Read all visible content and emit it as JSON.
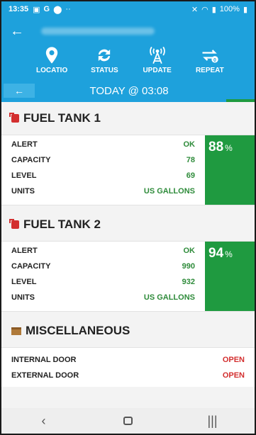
{
  "status_bar": {
    "time": "13:35",
    "battery": "100%"
  },
  "app_bar": {
    "back_icon": "arrow-left-icon"
  },
  "actions": [
    {
      "label": "LOCATIO",
      "icon": "location-pin-icon"
    },
    {
      "label": "STATUS",
      "icon": "refresh-icon"
    },
    {
      "label": "UPDATE",
      "icon": "antenna-icon"
    },
    {
      "label": "REPEAT",
      "icon": "repeat-icon"
    }
  ],
  "date_bar": {
    "text": "TODAY @ 03:08"
  },
  "sections": {
    "tank1": {
      "title": "FUEL TANK 1",
      "rows": [
        {
          "key": "ALERT",
          "value": "OK"
        },
        {
          "key": "CAPACITY",
          "value": "78"
        },
        {
          "key": "LEVEL",
          "value": "69"
        },
        {
          "key": "UNITS",
          "value": "US GALLONS"
        }
      ],
      "gauge_value": "88",
      "gauge_unit": "%"
    },
    "tank2": {
      "title": "FUEL TANK 2",
      "rows": [
        {
          "key": "ALERT",
          "value": "OK"
        },
        {
          "key": "CAPACITY",
          "value": "990"
        },
        {
          "key": "LEVEL",
          "value": "932"
        },
        {
          "key": "UNITS",
          "value": "US GALLONS"
        }
      ],
      "gauge_value": "94",
      "gauge_unit": "%"
    },
    "misc": {
      "title": "MISCELLANEOUS",
      "rows": [
        {
          "key": "INTERNAL DOOR",
          "value": "OPEN"
        },
        {
          "key": "EXTERNAL DOOR",
          "value": "OPEN"
        }
      ]
    }
  },
  "colors": {
    "primary": "#1ea1dc",
    "gauge": "#1f9a40",
    "ok": "#2e8b3a",
    "alert": "#d32f2f"
  }
}
